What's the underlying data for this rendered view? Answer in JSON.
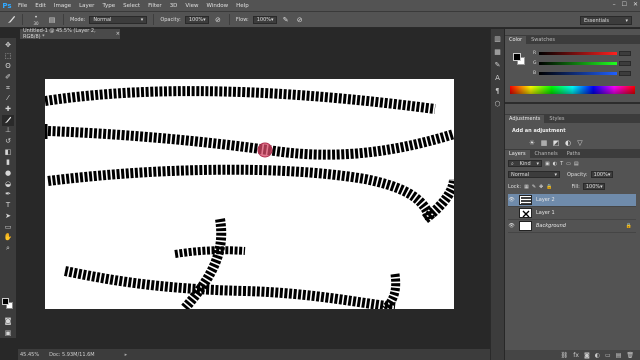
{
  "app": {
    "logo": "Ps"
  },
  "menu": [
    "File",
    "Edit",
    "Image",
    "Layer",
    "Type",
    "Select",
    "Filter",
    "3D",
    "View",
    "Window",
    "Help"
  ],
  "window_controls": [
    "–",
    "☐",
    "✕"
  ],
  "options_bar": {
    "brush_size": "30",
    "mode_label": "Mode:",
    "mode_value": "Normal",
    "opacity_label": "Opacity:",
    "opacity_value": "100%",
    "flow_label": "Flow:",
    "flow_value": "100%",
    "workspace": "Essentials"
  },
  "document": {
    "tab_title": "Untitled-1 @ 45.5% (Layer 2, RGB/8) *",
    "close": "×"
  },
  "status": {
    "zoom": "45.45%",
    "doc_info": "Doc: 5.93M/11.6M"
  },
  "color_panel": {
    "tabs": [
      "Color",
      "Swatches"
    ],
    "channels": [
      "R",
      "G",
      "B"
    ],
    "colors": {
      "r_bar": "#d23a3a",
      "g_bar": "#3aa83a",
      "b_bar": "#3a5ad2"
    }
  },
  "adjustments_panel": {
    "tabs": [
      "Adjustments",
      "Styles"
    ],
    "title": "Add an adjustment",
    "icons_row1": [
      "☀",
      "▦",
      "◩",
      "◐",
      "▽"
    ],
    "icons_row2": [
      "⚖",
      "▣",
      "◑",
      "◧",
      "▤",
      "▥"
    ],
    "icons_row3": [
      "◪",
      "◫",
      "▧",
      "▨"
    ]
  },
  "layers_panel": {
    "tabs": [
      "Layers",
      "Channels",
      "Paths"
    ],
    "filter_label": "Kind",
    "blend_mode": "Normal",
    "opacity_label": "Opacity:",
    "opacity_value": "100%",
    "lock_label": "Lock:",
    "fill_label": "Fill:",
    "fill_value": "100%",
    "layers": [
      {
        "name": "Layer 2",
        "selected": true
      },
      {
        "name": "Layer 1",
        "selected": false
      },
      {
        "name": "Background",
        "selected": false,
        "italic": true,
        "locked": true
      }
    ],
    "footer_icons": [
      "⛓",
      "fx",
      "◙",
      "◐",
      "▭",
      "▤",
      "🗑"
    ]
  }
}
